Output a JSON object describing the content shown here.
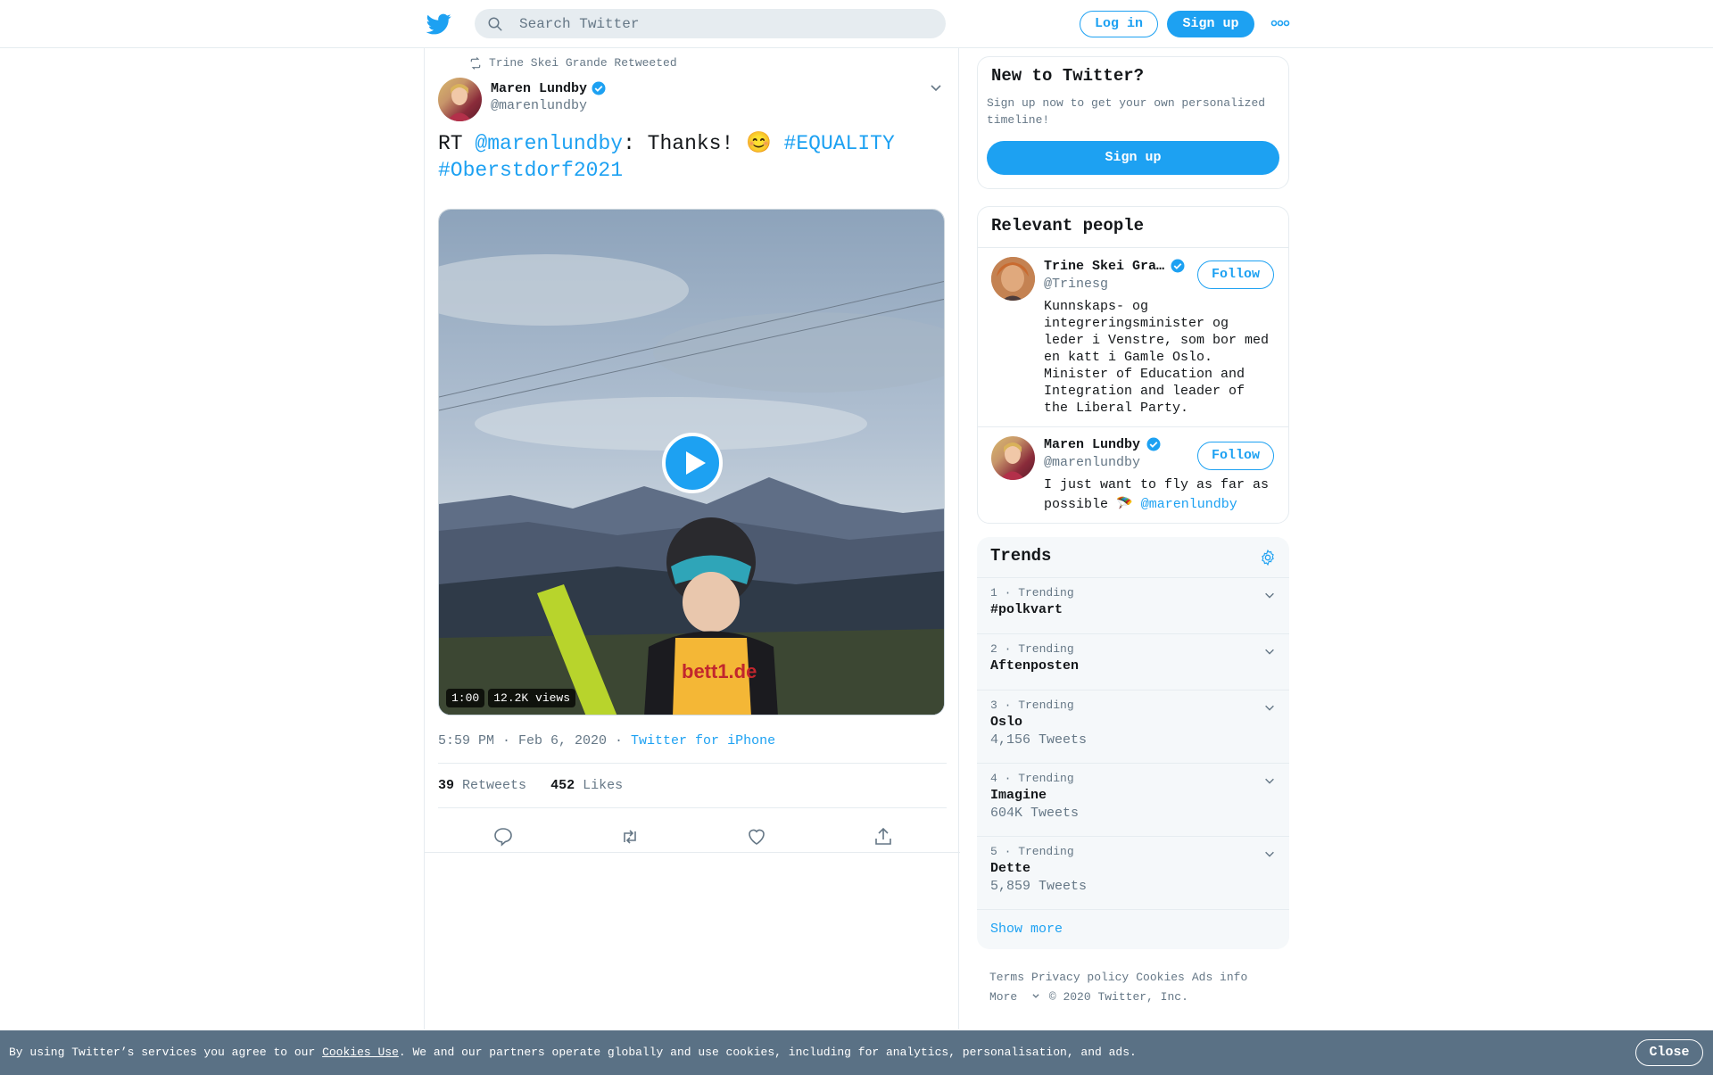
{
  "header": {
    "search_placeholder": "Search Twitter",
    "login_label": "Log in",
    "signup_label": "Sign up"
  },
  "tweet": {
    "retweeted_by": "Trine Skei Grande Retweeted",
    "author_name": "Maren Lundby",
    "author_handle": "@marenlundby",
    "text_prefix": "RT ",
    "mention": "@marenlundby",
    "text_mid": ": Thanks! 😊 ",
    "hashtag1": "#EQUALITY",
    "hashtag2": "#Oberstdorf2021",
    "video_duration": "1:00",
    "video_views": "12.2K views",
    "timestamp": "5:59 PM · Feb 6, 2020 · ",
    "source": "Twitter for iPhone",
    "retweets_count": "39",
    "retweets_label": "Retweets",
    "likes_count": "452",
    "likes_label": "Likes"
  },
  "new_to_twitter": {
    "title": "New to Twitter?",
    "desc": "Sign up now to get your own personalized timeline!",
    "button": "Sign up"
  },
  "relevant_people": {
    "title": "Relevant people",
    "people": [
      {
        "name": "Trine Skei Gra…",
        "handle": "@Trinesg",
        "bio": "Kunnskaps- og integreringsminister og leder i Venstre, som bor med en katt i Gamle Oslo. Minister of Education and Integration and leader of the Liberal Party.",
        "follow": "Follow"
      },
      {
        "name": "Maren Lundby",
        "handle": "@marenlundby",
        "bio": "I just want to fly as far as possible 🪂 ",
        "bio_link": "@marenlundby",
        "follow": "Follow"
      }
    ]
  },
  "trends": {
    "title": "Trends",
    "items": [
      {
        "meta": "1 · Trending",
        "name": "#polkvart",
        "count": ""
      },
      {
        "meta": "2 · Trending",
        "name": "Aftenposten",
        "count": ""
      },
      {
        "meta": "3 · Trending",
        "name": "Oslo",
        "count": "4,156 Tweets"
      },
      {
        "meta": "4 · Trending",
        "name": "Imagine",
        "count": "604K Tweets"
      },
      {
        "meta": "5 · Trending",
        "name": "Dette",
        "count": "5,859 Tweets"
      }
    ],
    "show_more": "Show more"
  },
  "footer": {
    "terms": "Terms",
    "privacy": "Privacy policy",
    "cookies": "Cookies",
    "ads": "Ads info",
    "more": "More",
    "copyright": "© 2020 Twitter, Inc."
  },
  "cookie_banner": {
    "text_before": "By using Twitter’s services you agree to our ",
    "link": "Cookies Use",
    "text_after": ". We and our partners operate globally and use cookies, including for analytics, personalisation, and ads.",
    "close": "Close"
  },
  "colors": {
    "accent": "#1da1f2",
    "banner": "#5a7185",
    "secondary_text": "#657786"
  }
}
